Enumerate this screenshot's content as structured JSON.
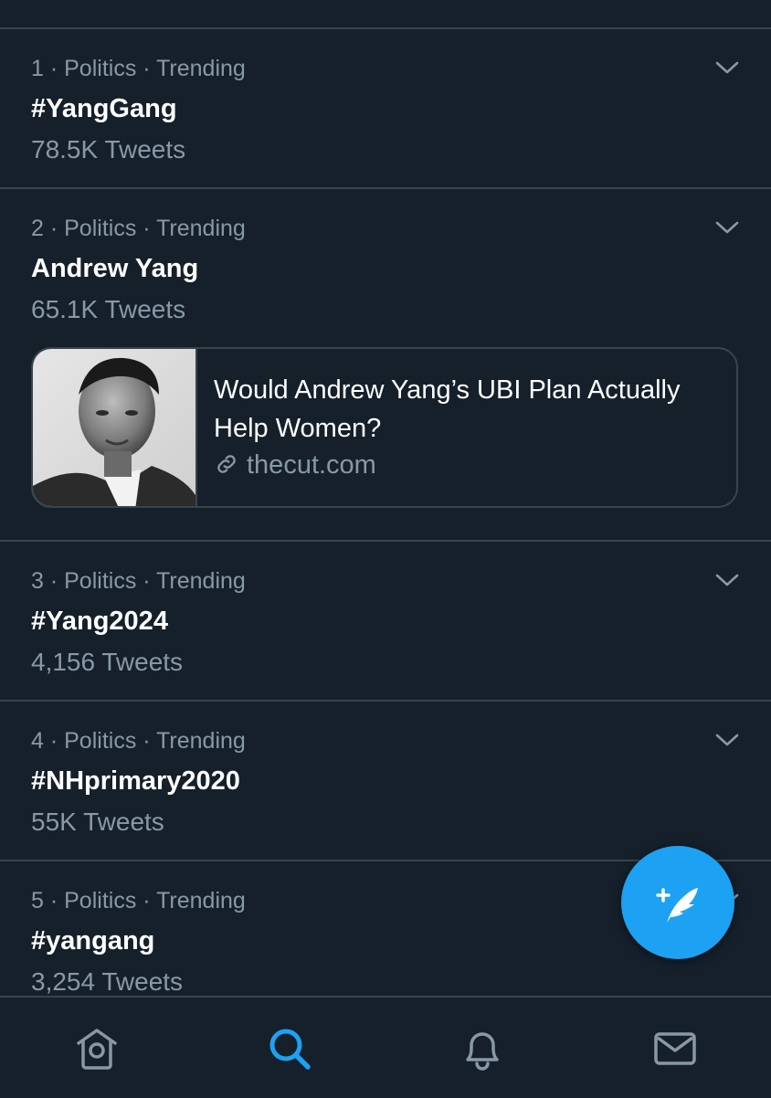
{
  "trends": [
    {
      "rank": "1",
      "meta": "· Politics · Trending",
      "title": "#YangGang",
      "count": "78.5K Tweets"
    },
    {
      "rank": "2",
      "meta": "· Politics · Trending",
      "title": "Andrew Yang",
      "count": "65.1K Tweets"
    },
    {
      "rank": "3",
      "meta": "· Politics · Trending",
      "title": "#Yang2024",
      "count": "4,156 Tweets"
    },
    {
      "rank": "4",
      "meta": "· Politics · Trending",
      "title": "#NHprimary2020",
      "count": "55K Tweets"
    },
    {
      "rank": "5",
      "meta": "· Politics · Trending",
      "title": "#yangang",
      "count": "3,254 Tweets"
    }
  ],
  "card": {
    "title": "Would Andrew Yang’s UBI Plan Actually Help Women?",
    "domain": "thecut.com",
    "link_icon": "link-icon",
    "thumbnail": "photo of Andrew Yang"
  },
  "fab": {
    "icon": "compose-tweet-icon"
  },
  "tabbar": {
    "items": [
      {
        "icon": "home-icon",
        "active": false
      },
      {
        "icon": "search-icon",
        "active": true
      },
      {
        "icon": "bell-icon",
        "active": false
      },
      {
        "icon": "mail-icon",
        "active": false
      }
    ]
  },
  "colors": {
    "background": "#15202b",
    "secondary_text": "#8899a6",
    "accent": "#1da1f2",
    "divider": "#38444d"
  }
}
